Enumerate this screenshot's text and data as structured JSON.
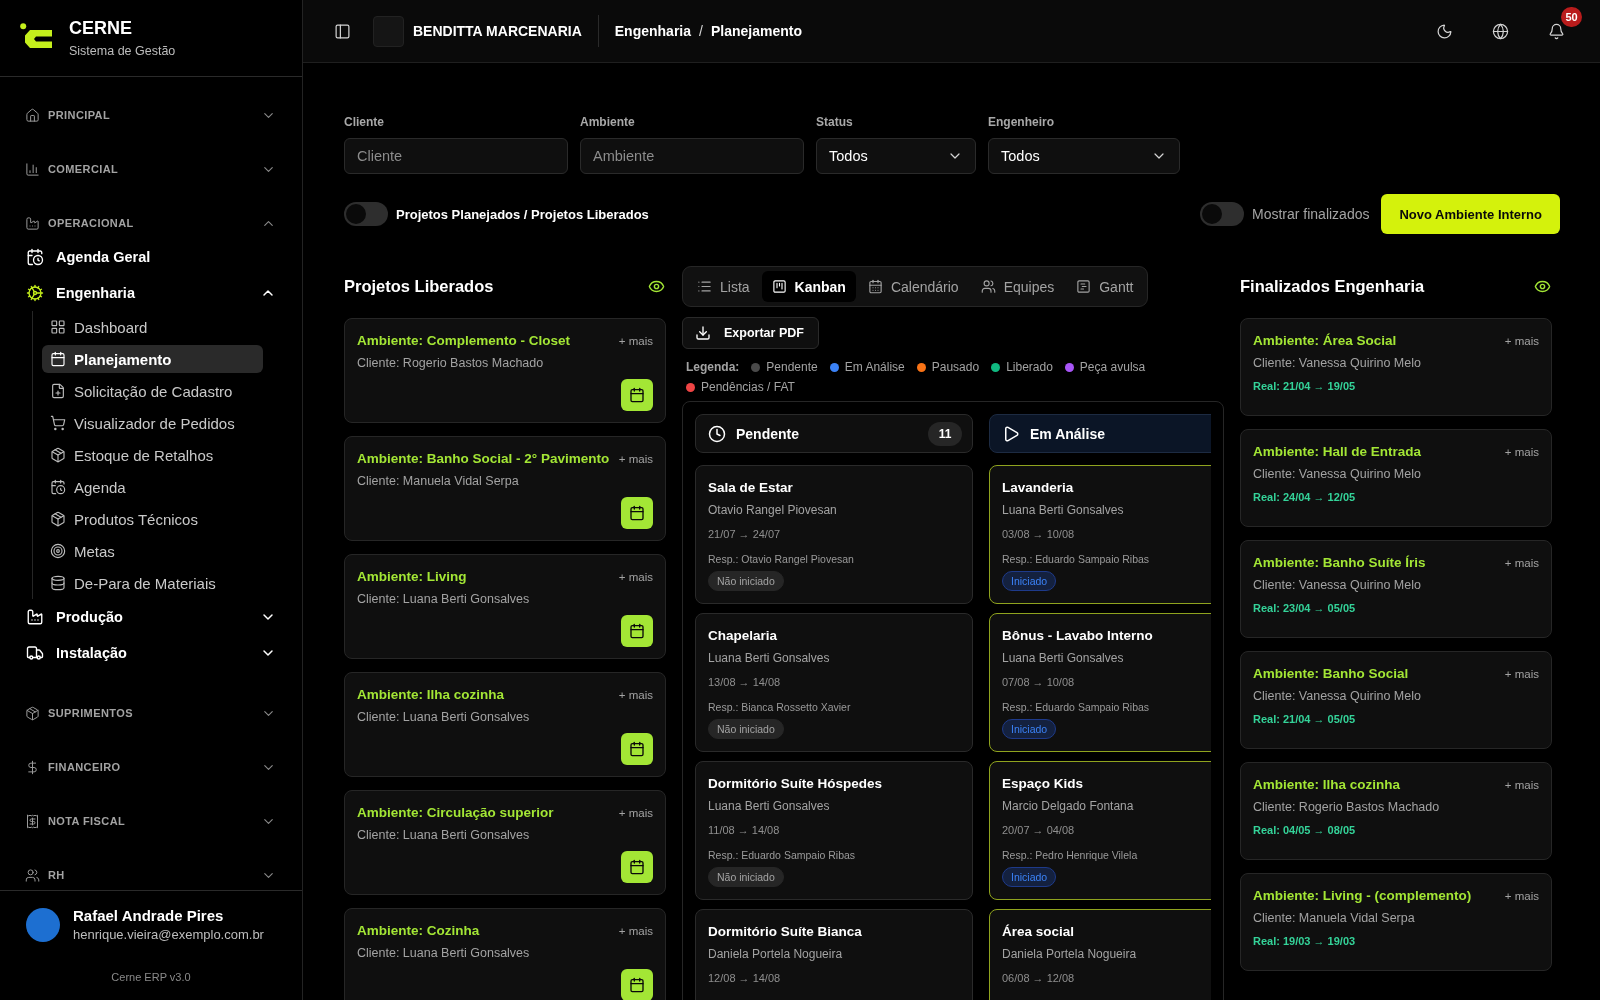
{
  "sidebar": {
    "brand": {
      "name": "CERNE",
      "subtitle": "Sistema de Gestão"
    },
    "sections": [
      {
        "label": "PRINCIPAL",
        "expanded": false
      },
      {
        "label": "COMERCIAL",
        "expanded": false
      },
      {
        "label": "OPERACIONAL",
        "expanded": true,
        "groups": [
          {
            "label": "Agenda Geral",
            "kind": "link",
            "active": false
          },
          {
            "label": "Engenharia",
            "kind": "folder",
            "active": true,
            "expanded": true,
            "children": [
              {
                "label": "Dashboard",
                "selected": false
              },
              {
                "label": "Planejamento",
                "selected": true
              },
              {
                "label": "Solicitação de Cadastro",
                "selected": false
              },
              {
                "label": "Visualizador de Pedidos",
                "selected": false
              },
              {
                "label": "Estoque de Retalhos",
                "selected": false
              },
              {
                "label": "Agenda",
                "selected": false
              },
              {
                "label": "Produtos Técnicos",
                "selected": false
              },
              {
                "label": "Metas",
                "selected": false
              },
              {
                "label": "De-Para de Materiais",
                "selected": false
              }
            ]
          },
          {
            "label": "Produção",
            "kind": "folder",
            "active": false,
            "expanded": false
          },
          {
            "label": "Instalação",
            "kind": "folder",
            "active": false,
            "expanded": false
          }
        ]
      },
      {
        "label": "SUPRIMENTOS",
        "expanded": false
      },
      {
        "label": "FINANCEIRO",
        "expanded": false
      },
      {
        "label": "NOTA FISCAL",
        "expanded": false
      },
      {
        "label": "RH",
        "expanded": false
      }
    ],
    "user": {
      "name": "Rafael Andrade Pires",
      "email": "henrique.vieira@exemplo.com.br"
    },
    "version": "Cerne ERP v3.0"
  },
  "topbar": {
    "company": "BENDITTA MARCENARIA",
    "breadcrumb": [
      "Engenharia",
      "Planejamento"
    ],
    "separator": "/",
    "notifications": "50"
  },
  "filters": [
    {
      "label": "Cliente",
      "kind": "input",
      "placeholder": "Cliente"
    },
    {
      "label": "Ambiente",
      "kind": "input",
      "placeholder": "Ambiente"
    },
    {
      "label": "Status",
      "kind": "select",
      "value": "Todos"
    },
    {
      "label": "Engenheiro",
      "kind": "select",
      "value": "Todos"
    }
  ],
  "mode_toggle": {
    "label": "Projetos Planejados / Projetos Liberados",
    "on": false
  },
  "finished_toggle": {
    "label": "Mostrar finalizados",
    "on": false
  },
  "new_button": "Novo Ambiente Interno",
  "released": {
    "title": "Projetos Liberados",
    "cards": [
      {
        "title": "Ambiente: Complemento - Closet",
        "client": "Cliente: Rogerio Bastos Machado",
        "more": "+ mais"
      },
      {
        "title": "Ambiente: Banho Social - 2° Pavimento",
        "client": "Cliente: Manuela Vidal Serpa",
        "more": "+ mais"
      },
      {
        "title": "Ambiente: Living",
        "client": "Cliente: Luana Berti Gonsalves",
        "more": "+ mais"
      },
      {
        "title": "Ambiente: Ilha cozinha",
        "client": "Cliente: Luana Berti Gonsalves",
        "more": "+ mais"
      },
      {
        "title": "Ambiente: Circulação superior",
        "client": "Cliente: Luana Berti Gonsalves",
        "more": "+ mais"
      },
      {
        "title": "Ambiente: Cozinha",
        "client": "Cliente: Luana Berti Gonsalves",
        "more": "+ mais"
      }
    ]
  },
  "views": [
    {
      "label": "Lista",
      "selected": false
    },
    {
      "label": "Kanban",
      "selected": true
    },
    {
      "label": "Calendário",
      "selected": false
    },
    {
      "label": "Equipes",
      "selected": false
    },
    {
      "label": "Gantt",
      "selected": false
    }
  ],
  "export_button": "Exportar PDF",
  "legend": {
    "label": "Legenda:",
    "items": [
      {
        "label": "Pendente",
        "color": "#4a4a4a"
      },
      {
        "label": "Em Análise",
        "color": "#3b82f6"
      },
      {
        "label": "Pausado",
        "color": "#f97316"
      },
      {
        "label": "Liberado",
        "color": "#10b981"
      },
      {
        "label": "Peça avulsa",
        "color": "#a855f7"
      },
      {
        "label": "Pendências / FAT",
        "color": "#ef4444"
      }
    ]
  },
  "kanban": {
    "columns": [
      {
        "title": "Pendente",
        "kind": "pending",
        "count": "11",
        "cards": [
          {
            "title": "Sala de Estar",
            "client": "Otavio Rangel Piovesan",
            "dates": "21/07 → 24/07",
            "resp": "Resp.: Otavio Rangel Piovesan",
            "status": {
              "label": "Não iniciado",
              "kind": "not_started"
            }
          },
          {
            "title": "Chapelaria",
            "client": "Luana Berti Gonsalves",
            "dates": "13/08 → 14/08",
            "resp": "Resp.: Bianca Rossetto Xavier",
            "status": {
              "label": "Não iniciado",
              "kind": "not_started"
            }
          },
          {
            "title": "Dormitório Suíte Hóspedes",
            "client": "Luana Berti Gonsalves",
            "dates": "11/08 → 14/08",
            "resp": "Resp.: Eduardo Sampaio Ribas",
            "status": {
              "label": "Não iniciado",
              "kind": "not_started"
            }
          },
          {
            "title": "Dormitório Suíte Bianca",
            "client": "Daniela Portela Nogueira",
            "dates": "12/08 → 14/08"
          }
        ]
      },
      {
        "title": "Em Análise",
        "kind": "analysis",
        "cards": [
          {
            "title": "Lavanderia",
            "client": "Luana Berti Gonsalves",
            "dates": "03/08 → 10/08",
            "resp": "Resp.: Eduardo Sampaio Ribas",
            "status": {
              "label": "Iniciado",
              "kind": "started"
            }
          },
          {
            "title": "Bônus - Lavabo Interno",
            "client": "Luana Berti Gonsalves",
            "dates": "07/08 → 10/08",
            "resp": "Resp.: Eduardo Sampaio Ribas",
            "status": {
              "label": "Iniciado",
              "kind": "started"
            }
          },
          {
            "title": "Espaço Kids",
            "client": "Marcio Delgado Fontana",
            "dates": "20/07 → 04/08",
            "resp": "Resp.: Pedro Henrique Vilela",
            "status": {
              "label": "Iniciado",
              "kind": "started"
            }
          },
          {
            "title": "Área social",
            "client": "Daniela Portela Nogueira",
            "dates": "06/08 → 12/08"
          }
        ]
      }
    ]
  },
  "finished": {
    "title": "Finalizados Engenharia",
    "cards": [
      {
        "title": "Ambiente: Área Social",
        "client": "Cliente: Vanessa Quirino Melo",
        "dates": "Real: 21/04 → 19/05",
        "more": "+ mais"
      },
      {
        "title": "Ambiente: Hall de Entrada",
        "client": "Cliente: Vanessa Quirino Melo",
        "dates": "Real: 24/04 → 12/05",
        "more": "+ mais"
      },
      {
        "title": "Ambiente: Banho Suíte Íris",
        "client": "Cliente: Vanessa Quirino Melo",
        "dates": "Real: 23/04 → 05/05",
        "more": "+ mais"
      },
      {
        "title": "Ambiente: Banho Social",
        "client": "Cliente: Vanessa Quirino Melo",
        "dates": "Real: 21/04 → 05/05",
        "more": "+ mais"
      },
      {
        "title": "Ambiente: Ilha cozinha",
        "client": "Cliente: Rogerio Bastos Machado",
        "dates": "Real: 04/05 → 08/05",
        "more": "+ mais"
      },
      {
        "title": "Ambiente: Living - (complemento)",
        "client": "Cliente: Manuela Vidal Serpa",
        "dates": "Real: 19/03 → 19/03",
        "more": "+ mais"
      }
    ]
  }
}
